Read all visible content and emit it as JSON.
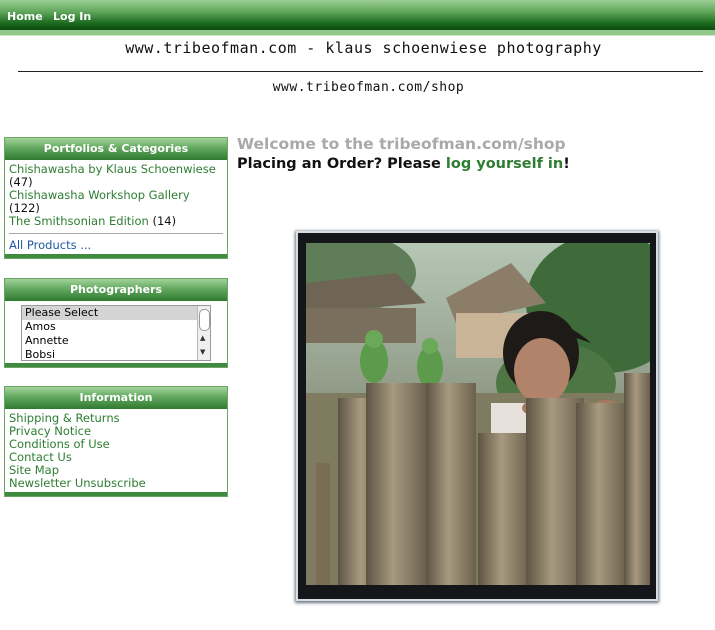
{
  "nav": {
    "home": "Home",
    "login": "Log In"
  },
  "header": {
    "site_title": "www.tribeofman.com - klaus schoenwiese photography",
    "subtitle": "www.tribeofman.com/shop"
  },
  "sidebar": {
    "categories": {
      "title": "Portfolios & Categories",
      "items": [
        {
          "label": "Chishawasha by Klaus Schoenwiese",
          "count": "(47)"
        },
        {
          "label": "Chishawasha Workshop Gallery",
          "count": "(122)"
        },
        {
          "label": "The Smithsonian Edition",
          "count": "(14)"
        }
      ],
      "all_products": "All Products ..."
    },
    "photographers": {
      "title": "Photographers",
      "options": [
        "Please Select",
        "Amos",
        "Annette",
        "Bobsi"
      ],
      "selected": "Please Select"
    },
    "information": {
      "title": "Information",
      "links": [
        "Shipping & Returns",
        "Privacy Notice",
        "Conditions of Use",
        "Contact Us",
        "Site Map",
        "Newsletter Unsubscribe"
      ]
    }
  },
  "main": {
    "welcome": "Welcome to the tribeofman.com/shop",
    "placing_prefix": "Placing an Order? Please ",
    "login_link": "log yourself in",
    "placing_suffix": "!"
  },
  "colors": {
    "accent_green": "#2e7d32",
    "header_green": "#0c4a0f",
    "welcome_gray": "#a9a9a9"
  }
}
